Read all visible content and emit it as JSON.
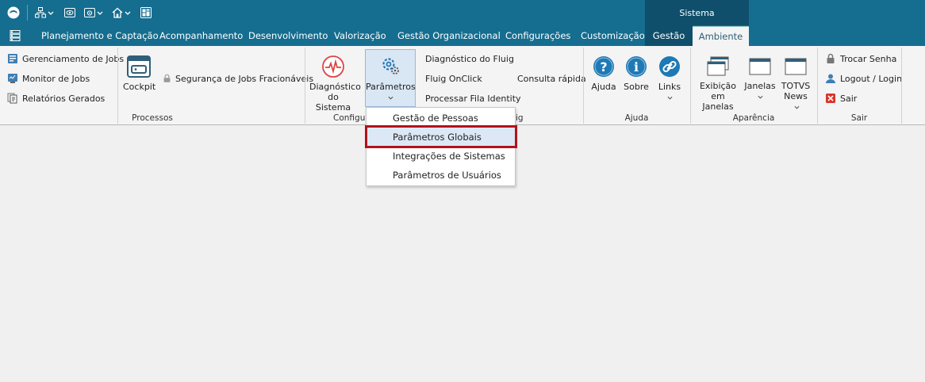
{
  "title_bar": {
    "context_tab": "Sistema"
  },
  "tabs": [
    {
      "label": "Planejamento e Captação"
    },
    {
      "label": "Acompanhamento"
    },
    {
      "label": "Desenvolvimento"
    },
    {
      "label": "Valorização"
    },
    {
      "label": "Gestão Organizacional"
    },
    {
      "label": "Configurações"
    },
    {
      "label": "Customização"
    },
    {
      "label": "Gestão"
    },
    {
      "label": "Ambiente"
    }
  ],
  "active_tab": "Ambiente",
  "ribbon": {
    "processos": {
      "label": "Processos",
      "items": [
        "Gerenciamento de Jobs",
        "Monitor de Jobs",
        "Relatórios Gerados"
      ],
      "cockpit": "Cockpit",
      "seguranca": "Segurança de Jobs Fracionáveis"
    },
    "configuracoes": {
      "label": "Configu",
      "diagnostico": [
        "Diagnóstico",
        "do Sistema"
      ],
      "parametros": "Parâmetros"
    },
    "fluig": {
      "label": "ig",
      "items": [
        "Diagnóstico do Fluig",
        "Fluig OnClick",
        "Processar Fila Identity"
      ],
      "consulta": "Consulta rápida"
    },
    "ajuda": {
      "label": "Ajuda",
      "ajuda": "Ajuda",
      "sobre": "Sobre",
      "links": "Links"
    },
    "aparencia": {
      "label": "Aparência",
      "exibicao": [
        "Exibição",
        "em Janelas"
      ],
      "janelas": "Janelas",
      "news": [
        "TOTVS",
        "News"
      ]
    },
    "sair": {
      "label": "Sair",
      "items": [
        "Trocar Senha",
        "Logout / Login",
        "Sair"
      ]
    }
  },
  "dropdown": {
    "items": [
      "Gestão de Pessoas",
      "Parâmetros Globais",
      "Integrações de Sistemas",
      "Parâmetros de Usuários"
    ],
    "highlighted": "Parâmetros Globais"
  },
  "colors": {
    "title_bar": "#156d8f",
    "context_tab": "#0f4f6b",
    "highlight_border": "#b3121a",
    "workspace": "#f0f0f0"
  }
}
